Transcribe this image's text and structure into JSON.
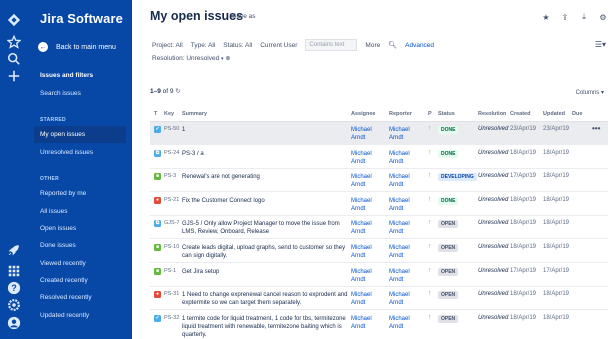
{
  "app": {
    "brand": "Jira Software",
    "back_label": "Back to main menu"
  },
  "sidebar": {
    "title": "Issues and filters",
    "search_issues": "Search issues",
    "starred_heading": "STARRED",
    "starred": [
      {
        "label": "My open issues",
        "active": true
      },
      {
        "label": "Unresolved issues",
        "active": false
      }
    ],
    "other_heading": "OTHER",
    "other": [
      {
        "label": "Reported by me"
      },
      {
        "label": "All issues"
      },
      {
        "label": "Open issues"
      },
      {
        "label": "Done issues"
      },
      {
        "label": "Viewed recently"
      },
      {
        "label": "Created recently"
      },
      {
        "label": "Resolved recently"
      },
      {
        "label": "Updated recently"
      }
    ]
  },
  "header": {
    "title": "My open issues",
    "save_as": "Save as"
  },
  "filters": {
    "project": "Project: All",
    "type": "Type: All",
    "status": "Status: All",
    "assignee": "Current User",
    "contains_placeholder": "Contains text",
    "more": "More",
    "advanced": "Advanced",
    "resolution": "Resolution: Unresolved"
  },
  "results": {
    "range": "1–9",
    "of": "of 9",
    "columns_label": "Columns"
  },
  "table": {
    "headers": {
      "t": "T",
      "key": "Key",
      "summary": "Summary",
      "assignee": "Assignee",
      "reporter": "Reporter",
      "p": "P",
      "status": "Status",
      "resolution": "Resolution",
      "created": "Created",
      "updated": "Updated",
      "due": "Due"
    },
    "rows": [
      {
        "type": "task",
        "key": "PS-50",
        "summary": "1",
        "assignee": [
          "Michael",
          "Arndt"
        ],
        "reporter": [
          "Michael",
          "Arndt"
        ],
        "status": "DONE",
        "resolution": "Unresolved",
        "created": "23/Apr/19",
        "updated": "23/Apr/19",
        "selected": true
      },
      {
        "type": "subtask",
        "key": "PS-24",
        "summary": "PS-3 / a",
        "assignee": [
          "Michael",
          "Arndt"
        ],
        "reporter": [
          "Michael",
          "Arndt"
        ],
        "status": "DONE",
        "resolution": "Unresolved",
        "created": "18/Apr/19",
        "updated": "18/Apr/19",
        "selected": false
      },
      {
        "type": "story",
        "key": "PS-3",
        "summary": "Renewal's are not generating",
        "assignee": [
          "Michael",
          "Arndt"
        ],
        "reporter": [
          "Michael",
          "Arndt"
        ],
        "status": "DEVELOPING",
        "resolution": "Unresolved",
        "created": "17/Apr/19",
        "updated": "18/Apr/19",
        "selected": false
      },
      {
        "type": "bug",
        "key": "PS-21",
        "summary": "Fix the Customer Connect logo",
        "assignee": [
          "Michael",
          "Arndt"
        ],
        "reporter": [
          "Michael",
          "Arndt"
        ],
        "status": "DONE",
        "resolution": "Unresolved",
        "created": "18/Apr/19",
        "updated": "18/Apr/19",
        "selected": false
      },
      {
        "type": "subtask",
        "key": "GJS-7",
        "summary": "GJS-5 / Only allow Project Manager to move the issue from LMS, Review, Onboard, Release",
        "assignee": [
          "Michael",
          "Arndt"
        ],
        "reporter": [
          "Michael",
          "Arndt"
        ],
        "status": "OPEN",
        "resolution": "Unresolved",
        "created": "18/Apr/19",
        "updated": "18/Apr/19",
        "selected": false
      },
      {
        "type": "story",
        "key": "PS-10",
        "summary": "Create leads digital, upload graphs, send to customer so they can sign digitally.",
        "assignee": [
          "Michael",
          "Arndt"
        ],
        "reporter": [
          "Michael",
          "Arndt"
        ],
        "status": "OPEN",
        "resolution": "Unresolved",
        "created": "18/Apr/19",
        "updated": "18/Apr/19",
        "selected": false
      },
      {
        "type": "story",
        "key": "PS-1",
        "summary": "Get Jira setup",
        "assignee": [
          "Michael",
          "Arndt"
        ],
        "reporter": [
          "Michael",
          "Arndt"
        ],
        "status": "OPEN",
        "resolution": "Unresolved",
        "created": "17/Apr/19",
        "updated": "17/Apr/19",
        "selected": false
      },
      {
        "type": "bug",
        "key": "PS-31",
        "summary": "1 Need to change exprenewal cancel reason to exprodent and exptermite so we can target them separately.",
        "assignee": [
          "Michael",
          "Arndt"
        ],
        "reporter": [
          "Michael",
          "Arndt"
        ],
        "status": "OPEN",
        "resolution": "Unresolved",
        "created": "18/Apr/19",
        "updated": "18/Apr/19",
        "selected": false
      },
      {
        "type": "task",
        "key": "PS-32",
        "summary": "1 termite code for liquid treatment, 1 code for tbs, termitezone liquid treatment with renewable, termitezone baiting which is quarterly.",
        "assignee": [
          "Michael",
          "Arndt"
        ],
        "reporter": [
          "Michael",
          "Arndt"
        ],
        "status": "OPEN",
        "resolution": "Unresolved",
        "created": "18/Apr/19",
        "updated": "18/Apr/19",
        "selected": false
      }
    ]
  },
  "colors": {
    "nav": "#0747a6",
    "link": "#0052cc",
    "task": "#4bade8",
    "subtask": "#4bade8",
    "story": "#63ba3c",
    "bug": "#e5493a",
    "done_bg": "#e3fcef",
    "done_fg": "#006644",
    "dev_bg": "#deebff",
    "dev_fg": "#0747a6",
    "open_bg": "#dfe1e6",
    "open_fg": "#42526e"
  }
}
